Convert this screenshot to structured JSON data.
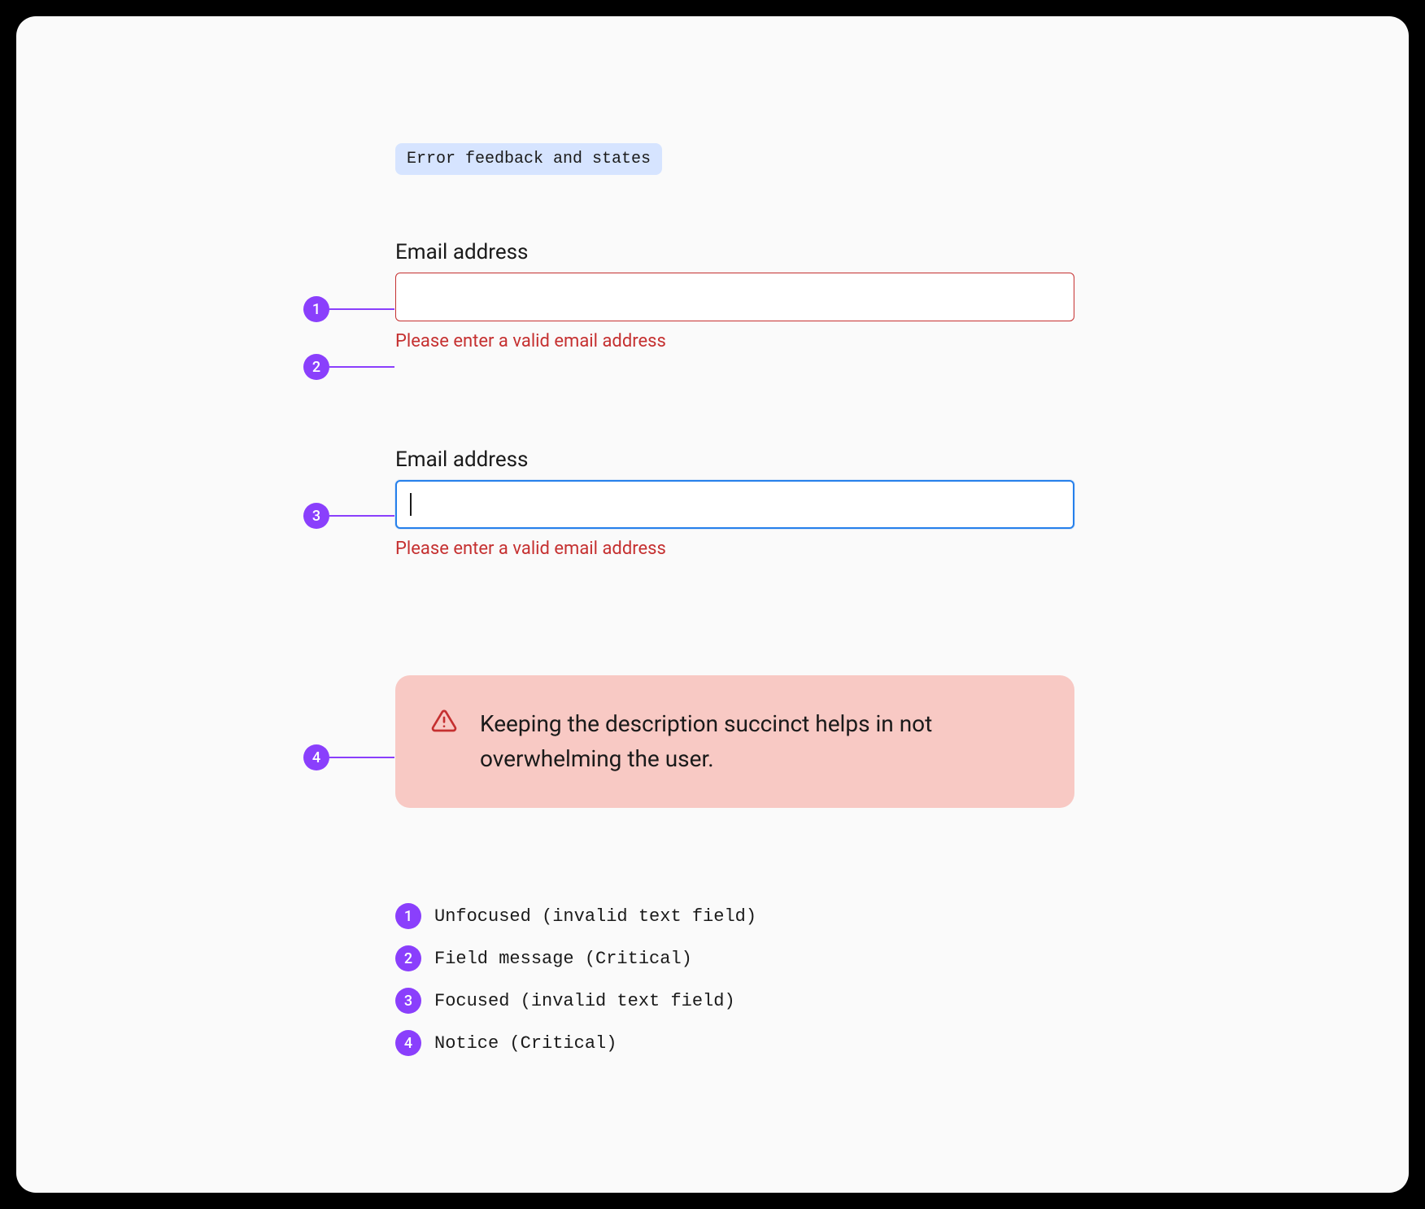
{
  "tag": "Error feedback and states",
  "fields": {
    "unfocused": {
      "label": "Email address",
      "value": "",
      "message": "Please enter a valid email address"
    },
    "focused": {
      "label": "Email address",
      "value": "",
      "message": "Please enter a valid email address"
    }
  },
  "notice": {
    "text": "Keeping the description succinct helps in not overwhelming the user."
  },
  "annotations": {
    "a1": "1",
    "a2": "2",
    "a3": "3",
    "a4": "4"
  },
  "legend": [
    {
      "num": "1",
      "text": "Unfocused (invalid text field)"
    },
    {
      "num": "2",
      "text": "Field message (Critical)"
    },
    {
      "num": "3",
      "text": "Focused (invalid text field)"
    },
    {
      "num": "4",
      "text": "Notice (Critical)"
    }
  ],
  "colors": {
    "accent_purple": "#8a3ffc",
    "error_red": "#c53030",
    "focus_blue": "#2680eb",
    "notice_bg": "#f8c9c4",
    "tag_bg": "#d6e4ff"
  }
}
